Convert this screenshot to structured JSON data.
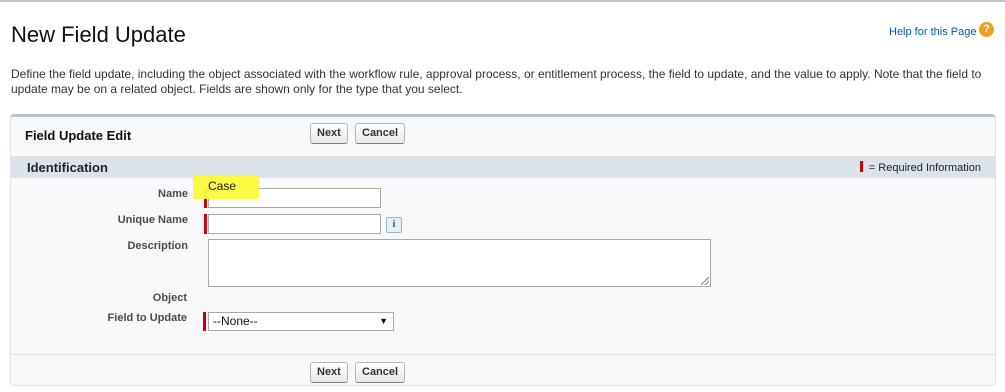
{
  "page": {
    "title": "New Field Update",
    "help_link": "Help for this Page",
    "help_icon": "?",
    "description": "Define the field update, including the object associated with the workflow rule, approval process, or entitlement process, the field to update, and the value to apply. Note that the field to update may be on a related object. Fields are shown only for the type that you select."
  },
  "panel": {
    "title": "Field Update Edit",
    "buttons": {
      "next": "Next",
      "cancel": "Cancel"
    },
    "section": {
      "title": "Identification",
      "required_legend": "= Required Information"
    },
    "fields": {
      "name_label": "Name",
      "name_value": "",
      "unique_name_label": "Unique Name",
      "unique_name_value": "",
      "info_icon": "i",
      "description_label": "Description",
      "description_value": "",
      "object_label": "Object",
      "object_value": "Case",
      "field_to_update_label": "Field to Update",
      "field_to_update_value": "--None--"
    }
  },
  "colors": {
    "required": "#cc0000",
    "highlight": "#fbfb3c",
    "section_bar": "#dde3ea",
    "link": "#015ba7"
  },
  "icons": {
    "help": "question-circle-icon",
    "info": "info-icon",
    "dropdown": "chevron-down-icon"
  }
}
